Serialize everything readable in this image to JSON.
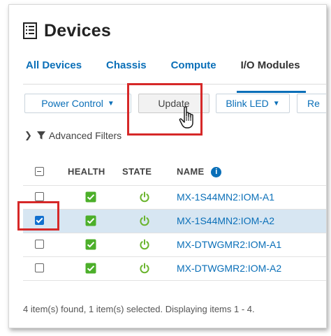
{
  "page": {
    "title": "Devices",
    "icon": "document-list-icon"
  },
  "tabs": [
    {
      "label": "All Devices",
      "active": false
    },
    {
      "label": "Chassis",
      "active": false
    },
    {
      "label": "Compute",
      "active": false
    },
    {
      "label": "I/O Modules",
      "active": true
    }
  ],
  "toolbar": {
    "power_control": "Power Control",
    "update": "Update",
    "blink_led": "Blink LED",
    "more": "Re"
  },
  "filters": {
    "advanced_label": "Advanced Filters"
  },
  "grid": {
    "columns": {
      "health": "HEALTH",
      "state": "STATE",
      "name": "NAME"
    },
    "rows": [
      {
        "name": "MX-1S44MN2:IOM-A1",
        "selected": false,
        "health": "ok",
        "state": "power-on"
      },
      {
        "name": "MX-1S44MN2:IOM-A2",
        "selected": true,
        "health": "ok",
        "state": "power-on"
      },
      {
        "name": "MX-DTWGMR2:IOM-A1",
        "selected": false,
        "health": "ok",
        "state": "power-on"
      },
      {
        "name": "MX-DTWGMR2:IOM-A2",
        "selected": false,
        "health": "ok",
        "state": "power-on"
      }
    ]
  },
  "footer": {
    "summary": "4 item(s) found, 1 item(s) selected. Displaying items 1 - 4."
  },
  "colors": {
    "accent": "#0a6fb8",
    "health_ok": "#4caf2a",
    "state_on": "#6ab42d",
    "highlight": "#d62828",
    "selected_row": "#d7e6f2"
  }
}
